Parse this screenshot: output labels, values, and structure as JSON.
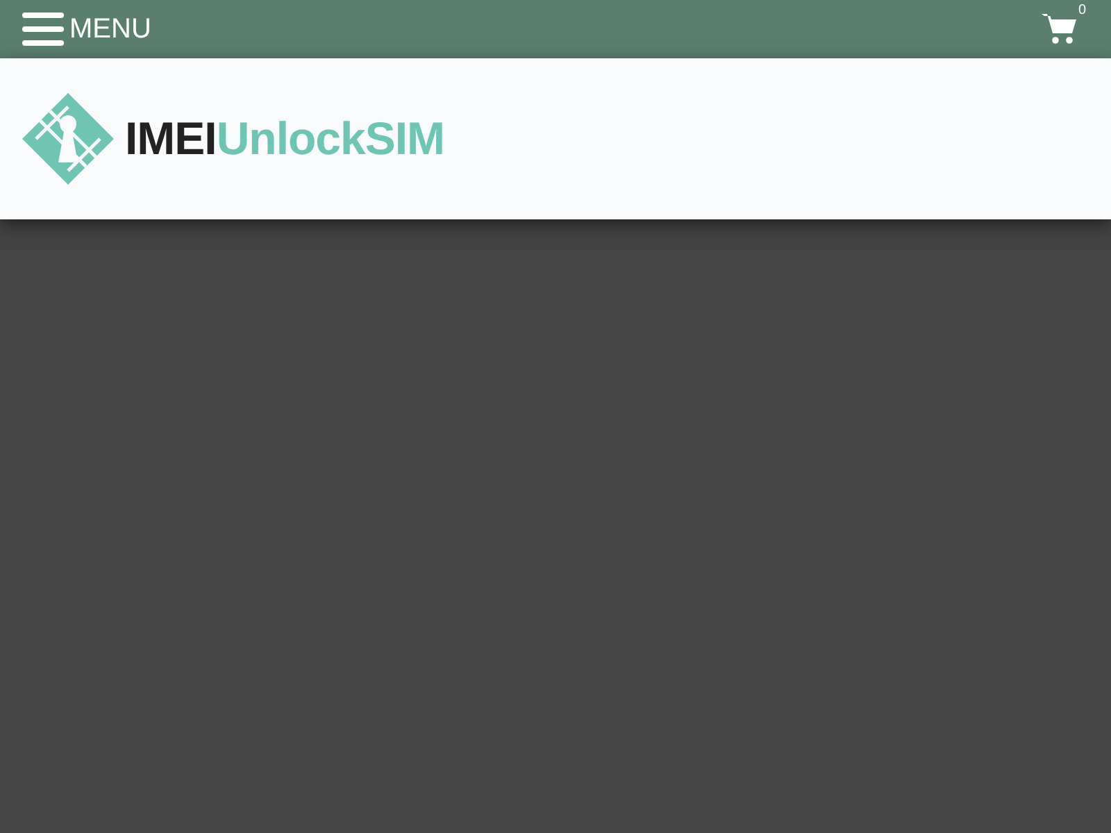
{
  "top_bar": {
    "menu_label": "MENU",
    "cart_count": "0"
  },
  "logo": {
    "dark_part": "IMEI",
    "light_part": "UnlockSIM"
  }
}
